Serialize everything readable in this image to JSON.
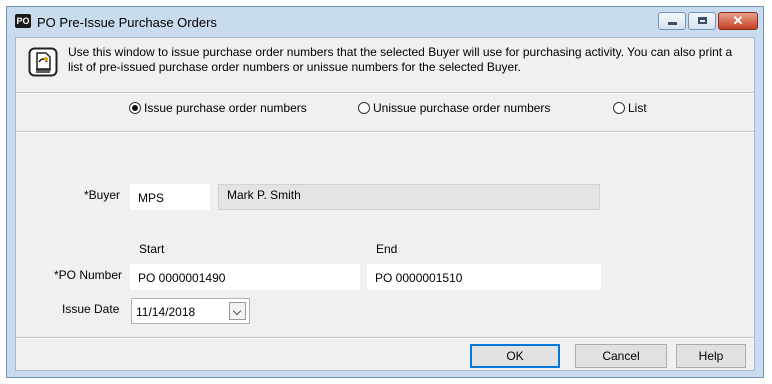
{
  "window": {
    "app_icon": "PO",
    "title": "PO Pre-Issue Purchase Orders",
    "close_glyph": "✕"
  },
  "info": {
    "icon": "document-info-icon",
    "text": "Use this window to issue purchase order numbers that the selected Buyer will use for purchasing activity. You can also print a list of pre-issued purchase order numbers or unissue numbers for the selected Buyer."
  },
  "mode": {
    "options": [
      {
        "label": "Issue purchase order numbers",
        "selected": true
      },
      {
        "label": "Unissue purchase order numbers",
        "selected": false
      },
      {
        "label": "List",
        "selected": false
      }
    ]
  },
  "form": {
    "buyer_label": "*Buyer",
    "buyer_code": "MPS",
    "buyer_name": "Mark P. Smith",
    "start_label": "Start",
    "end_label": "End",
    "po_number_label": "*PO Number",
    "po_start": "PO 0000001490",
    "po_end": "PO 0000001510",
    "issue_date_label": "Issue Date",
    "issue_date": "11/14/2018"
  },
  "buttons": {
    "ok": "OK",
    "cancel": "Cancel",
    "help": "Help"
  },
  "colors": {
    "frame": "#c9dbee",
    "client": "#f0f0f0",
    "close": "#c43f23",
    "default_button_border": "#0078d7"
  }
}
